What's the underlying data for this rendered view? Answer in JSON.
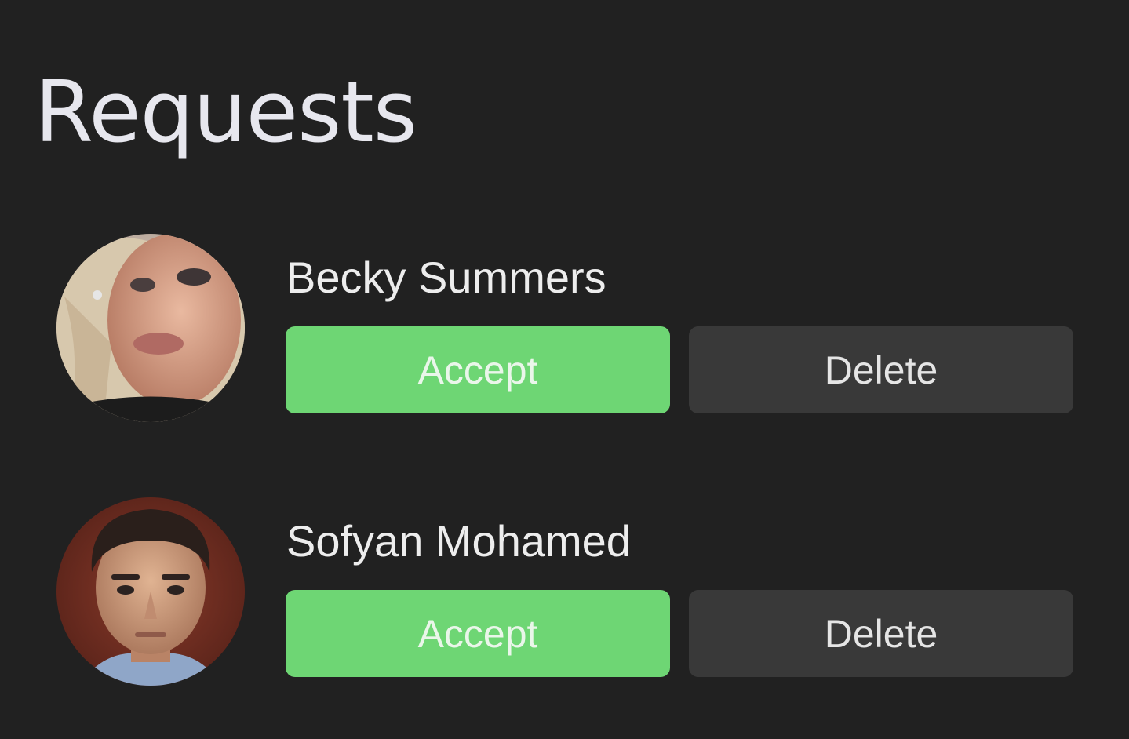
{
  "title": "Requests",
  "requests": [
    {
      "name": "Becky Summers",
      "avatar_icon": "avatar-photo-woman",
      "accept_label": "Accept",
      "delete_label": "Delete"
    },
    {
      "name": "Sofyan Mohamed",
      "avatar_icon": "avatar-photo-man",
      "accept_label": "Accept",
      "delete_label": "Delete"
    }
  ],
  "colors": {
    "background": "#212121",
    "accept": "#6ed674",
    "delete": "#393939",
    "text": "#ededed"
  }
}
